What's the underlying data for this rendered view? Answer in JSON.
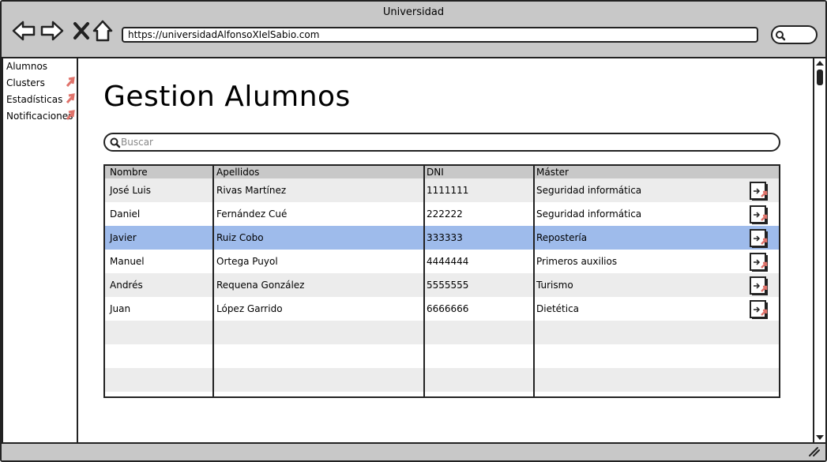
{
  "window": {
    "title": "Universidad"
  },
  "browser": {
    "url": "https://universidadAlfonsoXIelSabio.com"
  },
  "sidebar": {
    "items": [
      {
        "label": "Alumnos"
      },
      {
        "label": "Clusters"
      },
      {
        "label": "Estadísticas"
      },
      {
        "label": "Notificaciones"
      }
    ]
  },
  "page": {
    "title": "Gestion Alumnos"
  },
  "search": {
    "placeholder": "Buscar"
  },
  "table": {
    "headers": [
      "Nombre",
      "Apellidos",
      "DNI",
      "Máster"
    ],
    "rows": [
      {
        "nombre": "José Luis",
        "apellidos": "Rivas Martínez",
        "dni": "1111111",
        "master": " Seguridad informática"
      },
      {
        "nombre": "Daniel",
        "apellidos": "Fernández Cué",
        "dni": "222222",
        "master": "Seguridad informática"
      },
      {
        "nombre": "Javier",
        "apellidos": "Ruiz Cobo",
        "dni": "333333",
        "master": "Repostería"
      },
      {
        "nombre": "Manuel",
        "apellidos": "Ortega Puyol",
        "dni": "4444444",
        "master": "Primeros auxilios"
      },
      {
        "nombre": "Andrés",
        "apellidos": "Requena González",
        "dni": "5555555",
        "master": "Turismo"
      },
      {
        "nombre": "Juan",
        "apellidos": "López Garrido",
        "dni": "6666666",
        "master": "Dietética"
      }
    ],
    "selected_row": 3,
    "row_action_icon": "open-link-icon"
  },
  "colors": {
    "selected_row": "#9ebbeb",
    "alt_row": "#ececec",
    "chrome": "#c8c8c8",
    "accent_arrow": "#e0736b"
  }
}
